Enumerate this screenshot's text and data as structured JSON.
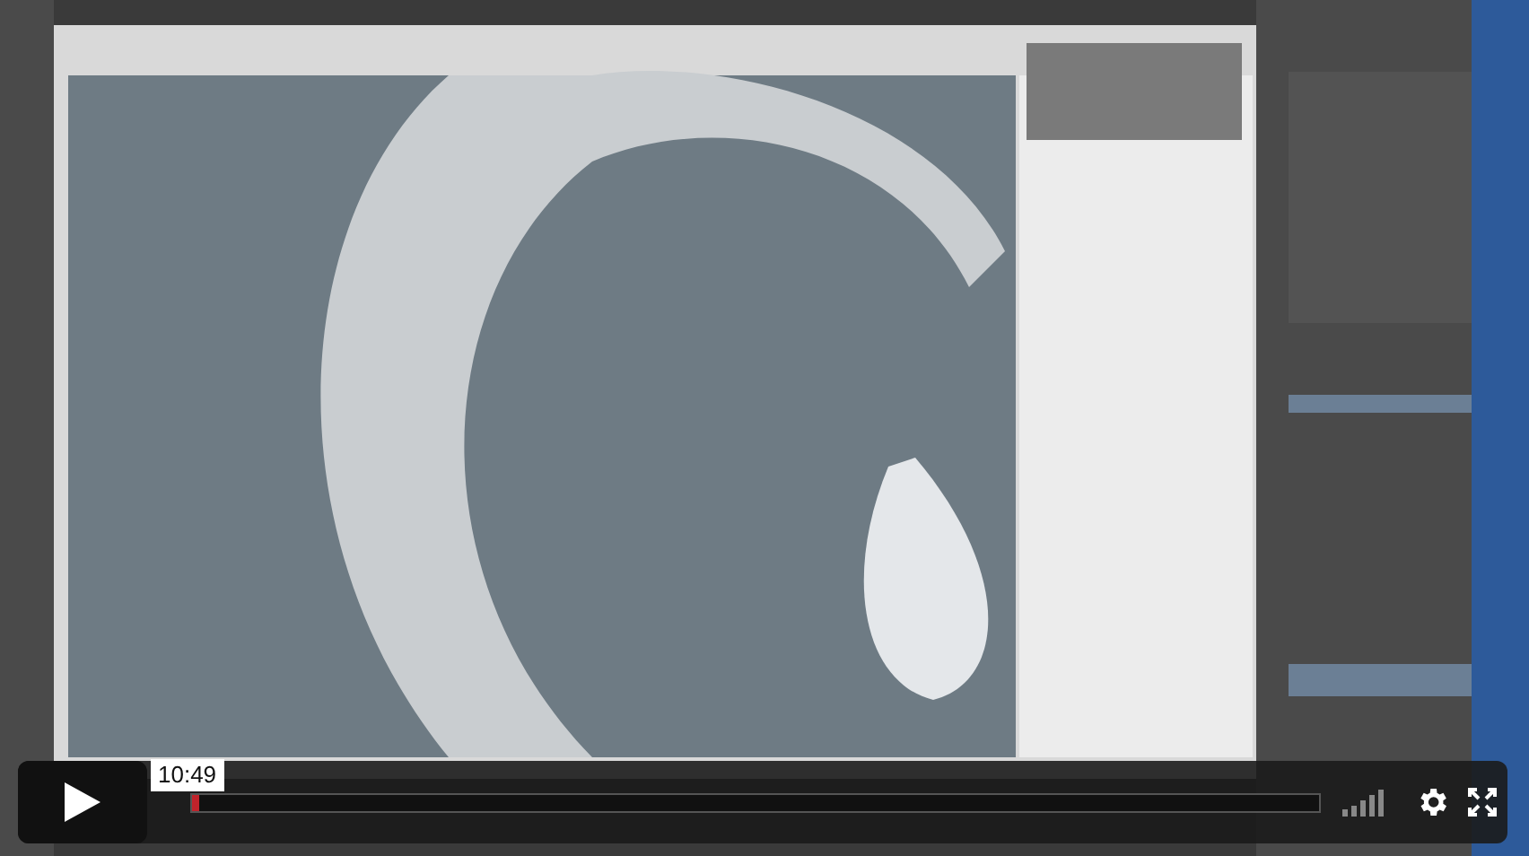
{
  "player": {
    "time": "10:49",
    "progress": {
      "level": 0.006
    }
  }
}
